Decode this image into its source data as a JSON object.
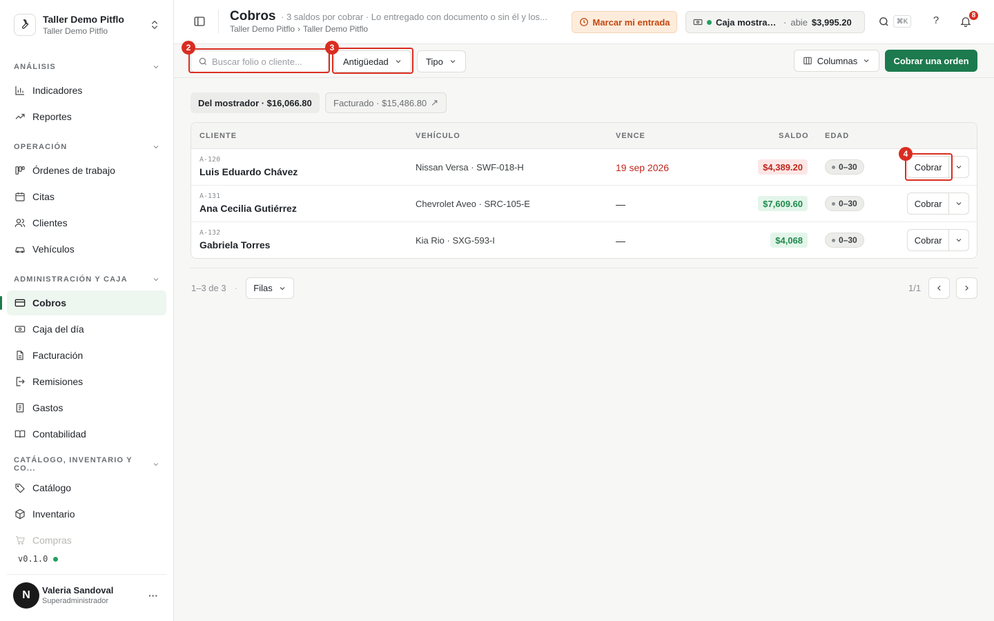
{
  "org": {
    "name": "Taller Demo Pitflo",
    "sub": "Taller Demo Pitflo"
  },
  "sidebar": {
    "sections": [
      {
        "title": "ANÁLISIS",
        "items": [
          {
            "label": "Indicadores",
            "icon": "bar-chart-icon"
          },
          {
            "label": "Reportes",
            "icon": "trend-icon"
          }
        ]
      },
      {
        "title": "OPERACIÓN",
        "items": [
          {
            "label": "Órdenes de trabajo",
            "icon": "work-orders-icon"
          },
          {
            "label": "Citas",
            "icon": "calendar-icon"
          },
          {
            "label": "Clientes",
            "icon": "users-icon"
          },
          {
            "label": "Vehículos",
            "icon": "car-icon"
          }
        ]
      },
      {
        "title": "ADMINISTRACIÓN Y CAJA",
        "items": [
          {
            "label": "Cobros",
            "icon": "credit-card-icon"
          },
          {
            "label": "Caja del día",
            "icon": "cash-icon"
          },
          {
            "label": "Facturación",
            "icon": "document-icon"
          },
          {
            "label": "Remisiones",
            "icon": "export-document-icon"
          },
          {
            "label": "Gastos",
            "icon": "receipt-icon"
          },
          {
            "label": "Contabilidad",
            "icon": "book-icon"
          }
        ]
      },
      {
        "title": "CATÁLOGO, INVENTARIO Y CO...",
        "items": [
          {
            "label": "Catálogo",
            "icon": "tag-icon"
          },
          {
            "label": "Inventario",
            "icon": "box-icon"
          },
          {
            "label": "Compras",
            "icon": "cart-icon"
          }
        ]
      }
    ],
    "version": "v0.1.0"
  },
  "user": {
    "name": "Valeria Sandoval",
    "role": "Superadministrador",
    "initial": "N"
  },
  "header": {
    "title": "Cobros",
    "description": "· 3 saldos por cobrar · Lo entregado con documento o sin él y los...",
    "breadcrumb": [
      "Taller Demo Pitflo",
      "›",
      "Taller Demo Pitflo"
    ],
    "clock_label": "Marcar mi entrada",
    "cash": {
      "name": "Caja mostrad...",
      "separator": "·",
      "state": "abie",
      "amount": "$3,995.20"
    },
    "shortcut": "⌘K",
    "help": "?",
    "notifications": "8"
  },
  "toolbar": {
    "search_placeholder": "Buscar folio o cliente...",
    "filter_age": "Antigüedad",
    "filter_type": "Tipo",
    "columns_label": "Columnas",
    "primary_label": "Cobrar una orden"
  },
  "annotations": [
    "2",
    "3",
    "4"
  ],
  "summary": {
    "counter": "Del mostrador · $16,066.80",
    "invoiced": "Facturado · $15,486.80",
    "invoiced_arrow": "↗"
  },
  "table": {
    "headers": {
      "client": "CLIENTE",
      "vehicle": "VEHÍCULO",
      "due": "VENCE",
      "balance": "SALDO",
      "age": "EDAD"
    },
    "rows": [
      {
        "folio": "A-120",
        "client": "Luis Eduardo Chávez",
        "vehicle": "Nissan Versa · SWF-018-H",
        "due": "19 sep 2026",
        "balance": "$4,389.20",
        "age": "0–30",
        "action": "Cobrar"
      },
      {
        "folio": "A-131",
        "client": "Ana Cecilia Gutiérrez",
        "vehicle": "Chevrolet Aveo · SRC-105-E",
        "due": "—",
        "balance": "$7,609.60",
        "age": "0–30",
        "action": "Cobrar"
      },
      {
        "folio": "A-132",
        "client": "Gabriela Torres",
        "vehicle": "Kia Rio · SXG-593-I",
        "due": "—",
        "balance": "$4,068",
        "age": "0–30",
        "action": "Cobrar"
      }
    ]
  },
  "pagination": {
    "count": "1–3 de 3",
    "dot": "·",
    "rows_label": "Filas",
    "page": "1/1"
  },
  "colors": {
    "accent": "#1c7a4e",
    "danger": "#d92d20",
    "warning_bg": "#fdecdc"
  }
}
